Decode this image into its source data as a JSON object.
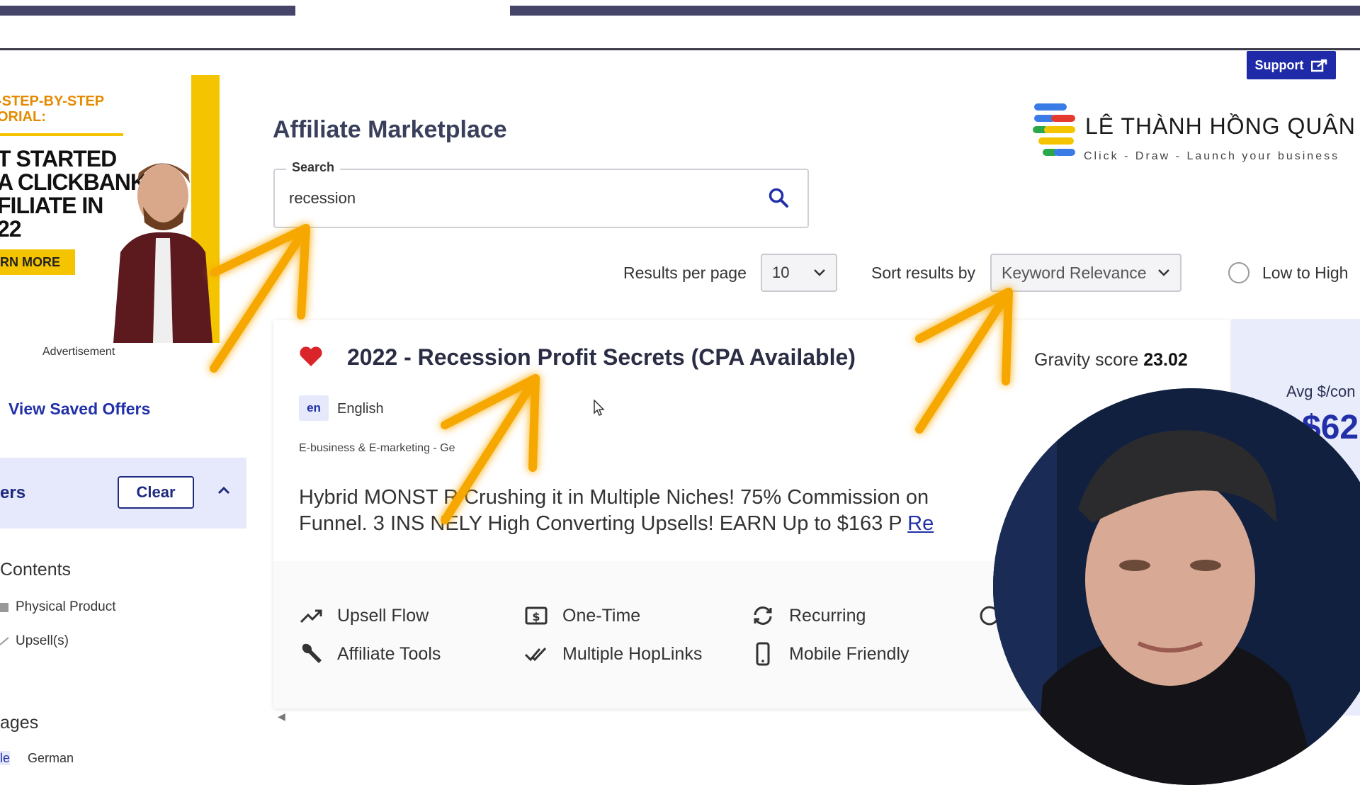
{
  "support": {
    "label": "Support"
  },
  "ad": {
    "subtitle": "-STEP-BY-STEP\nORIAL:",
    "headline": "T STARTED\nA CLICKBANK\nFILIATE IN\n22",
    "cta": "RN MORE",
    "caption": "Advertisement"
  },
  "sidebar": {
    "view_saved": "View Saved Offers",
    "filters_title": "ers",
    "clear_label": "Clear",
    "contents_heading": "Contents",
    "contents_items": [
      "Physical Product",
      "Upsell(s)"
    ],
    "languages_heading": "ages",
    "language_item": "German",
    "language_prefix": "le"
  },
  "main": {
    "title": "Affiliate Marketplace",
    "search": {
      "label": "Search",
      "value": "recession"
    },
    "results_per_page": {
      "label": "Results per page",
      "value": "10"
    },
    "sort": {
      "label": "Sort results by",
      "value": "Keyword Relevance"
    },
    "order": {
      "label": "Low to High"
    }
  },
  "offer": {
    "title": "2022 - Recession Profit Secrets (CPA Available)",
    "gravity_label": "Gravity score",
    "gravity_value": "23.02",
    "lang_code": "en",
    "lang_name": "English",
    "category": "E-business & E-marketing - Ge",
    "desc_line1": "Hybrid MONST R Crushing it in Multiple Niches! 75% Commission on",
    "desc_line2": "Funnel. 3 INS NELY High Converting Upsells! EARN Up to $163 P",
    "desc_link": "Re",
    "features": [
      "Upsell Flow",
      "One-Time",
      "Recurring",
      "Affiliate Tools",
      "Multiple HopLinks",
      "Mobile Friendly"
    ],
    "avg_label": "Avg $/con",
    "avg_value": "$62"
  },
  "logo": {
    "title": "LÊ THÀNH HỒNG QUÂN",
    "tagline": "Click - Draw - Launch your business"
  },
  "colors": {
    "primary": "#2130a8",
    "accent_yellow": "#f5c400",
    "arrow": "#f7a800",
    "heart": "#d9252a"
  }
}
